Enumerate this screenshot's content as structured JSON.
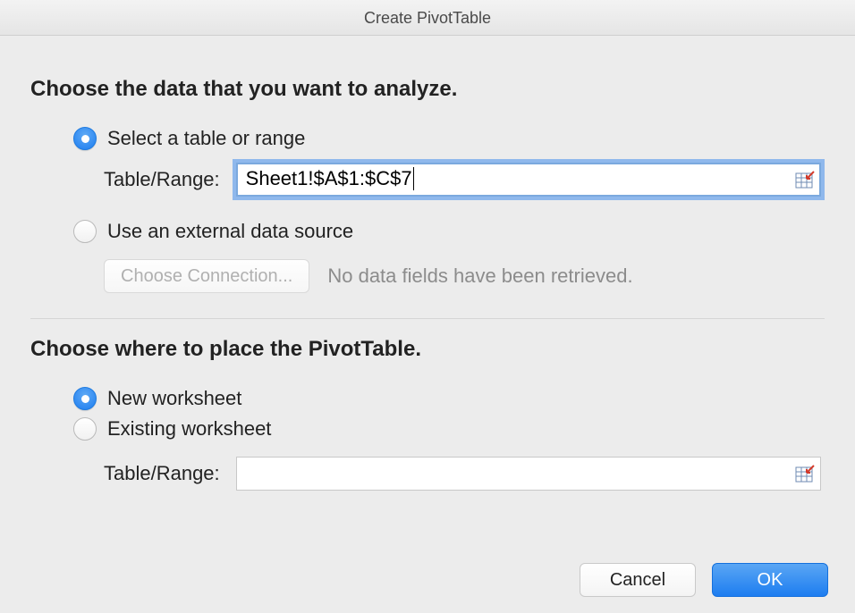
{
  "window": {
    "title": "Create PivotTable"
  },
  "section1": {
    "heading": "Choose the data that you want to analyze.",
    "option_select_range": "Select a table or range",
    "table_range_label": "Table/Range:",
    "table_range_value": "Sheet1!$A$1:$C$7",
    "option_external": "Use an external data source",
    "choose_connection_label": "Choose Connection...",
    "no_data_fields": "No data fields have been retrieved."
  },
  "section2": {
    "heading": "Choose where to place the PivotTable.",
    "option_new_ws": "New worksheet",
    "option_existing_ws": "Existing worksheet",
    "table_range_label": "Table/Range:",
    "table_range_value": ""
  },
  "footer": {
    "cancel": "Cancel",
    "ok": "OK"
  }
}
